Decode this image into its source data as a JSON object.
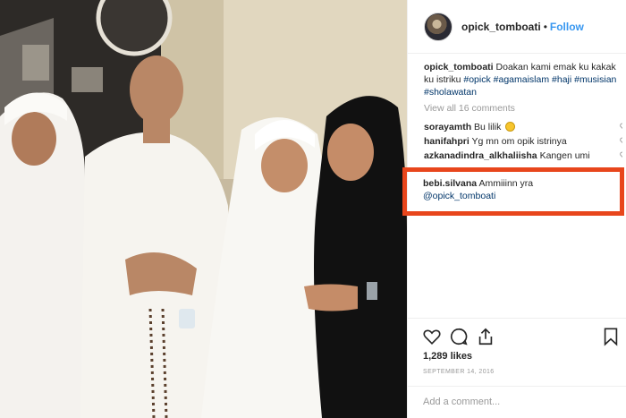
{
  "header": {
    "username": "opick_tomboati",
    "separator": "•",
    "follow_label": "Follow"
  },
  "caption": {
    "username": "opick_tomboati",
    "text": "Doakan kami emak ku kakak ku istriku",
    "hashtags": [
      "#opick",
      "#agamaislam",
      "#haji",
      "#musisian",
      "#sholawatan"
    ]
  },
  "view_all_label": "View all 16 comments",
  "comments": [
    {
      "user": "sorayamth",
      "text": "Bu lilik",
      "emoji": "smile-emoji"
    },
    {
      "user": "hanifahpri",
      "text": "Yg mn om opik istrinya"
    },
    {
      "user": "azkanadindra_alkhaliisha",
      "text": "Kangen umi"
    }
  ],
  "highlighted_comment": {
    "user": "bebi.silvana",
    "text": "Ammiiinn yra",
    "mention": "@opick_tomboati",
    "highlight_color": "#e8461c"
  },
  "actions": {
    "icons": [
      "heart-icon",
      "comment-icon",
      "share-icon",
      "bookmark-icon"
    ],
    "likes": "1,289 likes",
    "date": "SEPTEMBER 14, 2016",
    "add_comment_placeholder": "Add a comment..."
  },
  "colors": {
    "link": "#3897f0",
    "hashtag": "#003569",
    "muted": "#999999",
    "highlight": "#e8461c"
  }
}
